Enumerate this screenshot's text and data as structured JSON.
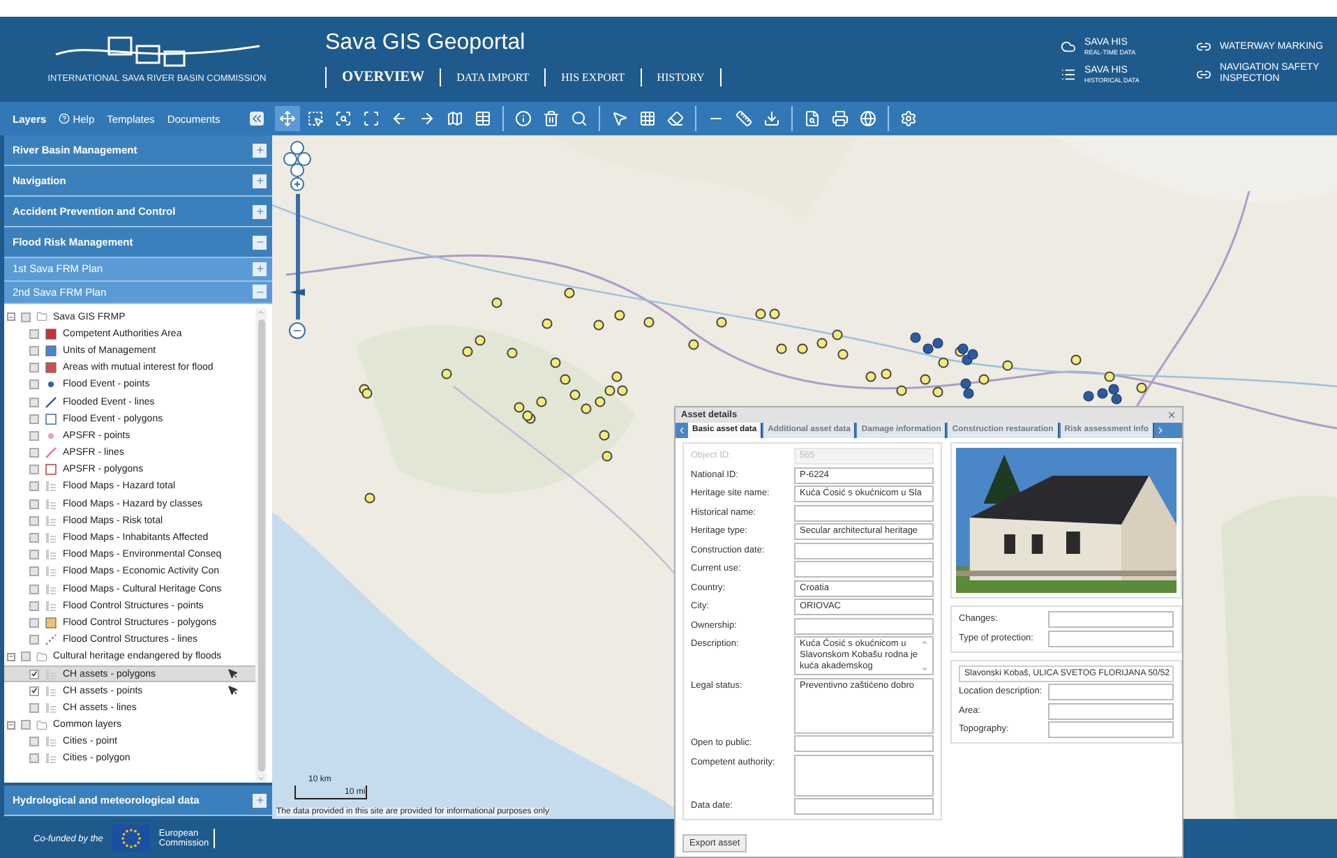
{
  "header": {
    "logo_caption": "INTERNATIONAL SAVA RIVER BASIN COMMISSION",
    "title": "Sava GIS Geoportal",
    "nav": [
      {
        "label": "OVERVIEW",
        "selected": true
      },
      {
        "label": "DATA IMPORT",
        "selected": false
      },
      {
        "label": "HIS EXPORT",
        "selected": false
      },
      {
        "label": "HISTORY",
        "selected": false
      }
    ],
    "links": [
      {
        "kind": "cloud",
        "title": "SAVA HIS",
        "subtitle": "REAL-TIME DATA"
      },
      {
        "kind": "list",
        "title": "SAVA HIS",
        "subtitle": "HISTORICAL DATA"
      },
      {
        "kind": "link",
        "title": "WATERWAY MARKING"
      },
      {
        "kind": "link",
        "title": "NAVIGATION SAFETY INSPECTION"
      }
    ]
  },
  "layers_panel": {
    "tabs": [
      {
        "label": "Layers",
        "selected": true,
        "kind": "plain"
      },
      {
        "label": "Help",
        "selected": false,
        "kind": "help"
      },
      {
        "label": "Templates",
        "selected": false,
        "kind": "plain"
      },
      {
        "label": "Documents",
        "selected": false,
        "kind": "plain"
      }
    ],
    "sections": [
      {
        "label": "River Basin Management",
        "kind": "main",
        "expanded": false
      },
      {
        "label": "Navigation",
        "kind": "main",
        "expanded": false
      },
      {
        "label": "Accident Prevention and Control",
        "kind": "main",
        "expanded": false
      },
      {
        "label": "Flood Risk Management",
        "kind": "main",
        "expanded": true
      },
      {
        "label": "1st Sava FRM Plan",
        "kind": "sub",
        "expanded": false
      },
      {
        "label": "2nd Sava FRM Plan",
        "kind": "sub",
        "expanded": true
      }
    ],
    "tree": [
      {
        "label": "Sava GIS FRMP",
        "kind": "folder",
        "expanded": true,
        "checked": false,
        "children": [
          {
            "label": "Competent Authorities Area",
            "kind": "fill",
            "color": "#c8303a",
            "checked": false,
            "selected": false,
            "identify": false
          },
          {
            "label": "Units of Management",
            "kind": "fill",
            "color": "#4a86d8",
            "checked": false,
            "selected": false,
            "identify": false
          },
          {
            "label": "Areas with mutual interest for flood",
            "kind": "fill",
            "color": "#d05050",
            "checked": false,
            "selected": false,
            "identify": false
          },
          {
            "label": "Flood Event - points",
            "kind": "dot",
            "color": "#3060b0",
            "checked": false,
            "selected": false,
            "identify": false
          },
          {
            "label": "Flooded Event - lines",
            "kind": "line",
            "color": "#3050a0",
            "checked": false,
            "selected": false,
            "identify": false
          },
          {
            "label": "Flood Event - polygons",
            "kind": "outline",
            "color": "#7090b8",
            "checked": false,
            "selected": false,
            "identify": false
          },
          {
            "label": "APSFR - points",
            "kind": "dot",
            "color": "#f0a0a8",
            "checked": false,
            "selected": false,
            "identify": false
          },
          {
            "label": "APSFR - lines",
            "kind": "line",
            "color": "#e07080",
            "checked": false,
            "selected": false,
            "identify": false
          },
          {
            "label": "APSFR - polygons",
            "kind": "outline",
            "color": "#c07070",
            "checked": false,
            "selected": false,
            "identify": false
          },
          {
            "label": "Flood Maps - Hazard total",
            "kind": "legend",
            "checked": false,
            "selected": false,
            "identify": false
          },
          {
            "label": "Flood Maps - Hazard by classes",
            "kind": "legend",
            "checked": false,
            "selected": false,
            "identify": false
          },
          {
            "label": "Flood Maps - Risk total",
            "kind": "legend",
            "checked": false,
            "selected": false,
            "identify": false
          },
          {
            "label": "Flood Maps - Inhabitants Affected",
            "kind": "legend",
            "checked": false,
            "selected": false,
            "identify": false
          },
          {
            "label": "Flood Maps - Environmental Conseq",
            "kind": "legend",
            "checked": false,
            "selected": false,
            "identify": false
          },
          {
            "label": "Flood Maps - Economic Activity Con",
            "kind": "legend",
            "checked": false,
            "selected": false,
            "identify": false
          },
          {
            "label": "Flood Maps - Cultural Heritage Cons",
            "kind": "legend",
            "checked": false,
            "selected": false,
            "identify": false
          },
          {
            "label": "Flood Control Structures - points",
            "kind": "legend",
            "checked": false,
            "selected": false,
            "identify": false
          },
          {
            "label": "Flood Control Structures - polygons",
            "kind": "fill",
            "color": "#f0c070",
            "checked": false,
            "selected": false,
            "identify": false
          },
          {
            "label": "Flood Control Structures - lines",
            "kind": "dashes",
            "color": "#c06090",
            "checked": false,
            "selected": false,
            "identify": false
          }
        ]
      },
      {
        "label": "Cultural heritage endangered by floods",
        "kind": "folder",
        "expanded": true,
        "checked": false,
        "children": [
          {
            "label": "CH assets - polygons",
            "kind": "legend",
            "checked": true,
            "selected": true,
            "identify": true
          },
          {
            "label": "CH assets - points",
            "kind": "legend",
            "checked": true,
            "selected": false,
            "identify": true
          },
          {
            "label": "CH assets - lines",
            "kind": "legend",
            "checked": false,
            "selected": false,
            "identify": false
          }
        ]
      },
      {
        "label": "Common layers",
        "kind": "folder",
        "expanded": true,
        "checked": false,
        "children": [
          {
            "label": "Cities - point",
            "kind": "legend",
            "checked": false,
            "selected": false,
            "identify": false
          },
          {
            "label": "Cities - polygon",
            "kind": "legend",
            "checked": false,
            "selected": false,
            "identify": false
          }
        ]
      }
    ],
    "bottom_section": {
      "label": "Hydrological and meteorological data",
      "expanded": false
    }
  },
  "map": {
    "zoom_slider": {
      "level": 0.2
    },
    "scale": {
      "metric": "10 km",
      "imperial": "10 mi"
    },
    "disclaimer": "The data provided in this site are provided for informational purposes only"
  },
  "asset_details": {
    "title": "Asset details",
    "tabs": [
      {
        "label": "Basic asset data",
        "selected": true
      },
      {
        "label": "Additional asset data",
        "selected": false
      },
      {
        "label": "Damage information",
        "selected": false
      },
      {
        "label": "Construction restauration",
        "selected": false
      },
      {
        "label": "Risk assessment info",
        "selected": false
      }
    ],
    "fields": [
      {
        "label": "Object ID:",
        "value": "565",
        "kind": "input",
        "disabled": true
      },
      {
        "label": "National ID:",
        "value": "P-6224",
        "kind": "input",
        "disabled": false
      },
      {
        "label": "Heritage site name:",
        "value": "Kuća Ćosić s okućnicom u Sla",
        "kind": "input",
        "disabled": false
      },
      {
        "label": "Historical name:",
        "kind": "input",
        "disabled": false
      },
      {
        "label": "Heritage type:",
        "value": "Secular architectural heritage",
        "kind": "input",
        "disabled": false
      },
      {
        "label": "Construction date:",
        "kind": "input",
        "disabled": false
      },
      {
        "label": "Current use:",
        "kind": "input",
        "disabled": false
      },
      {
        "label": "Country:",
        "value": "Croatia",
        "kind": "input",
        "disabled": false
      },
      {
        "label": "City:",
        "value": "ORIOVAC",
        "kind": "input",
        "disabled": false
      },
      {
        "label": "Ownership:",
        "kind": "input",
        "disabled": false
      },
      {
        "label": "Description:",
        "value": "Kuća Ćosić s okućnicom u Slavonskom Kobašu rodna je kuća akademskog",
        "kind": "scroll",
        "disabled": false
      },
      {
        "label": "Legal status:",
        "value": "Preventivno zaštićeno dobro",
        "kind": "textarea",
        "disabled": false
      },
      {
        "label": "Open to public:",
        "kind": "input",
        "disabled": false
      },
      {
        "label": "Competent authority:",
        "kind": "textarea",
        "disabled": false
      },
      {
        "label": "Data date:",
        "kind": "input",
        "disabled": false
      }
    ],
    "protection_fields": [
      {
        "label": "Changes:"
      },
      {
        "label": "Type of protection:"
      }
    ],
    "address": "Slavonski Kobaš, ULICA SVETOG FLORIJANA 50/52",
    "location_fields": [
      {
        "label": "Location description:"
      },
      {
        "label": "Area:"
      },
      {
        "label": "Topography:"
      }
    ],
    "export_button": "Export asset"
  },
  "footer": {
    "cofunded": "Co-funded by the",
    "commission": "European Commission"
  }
}
